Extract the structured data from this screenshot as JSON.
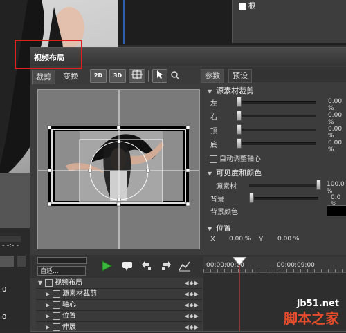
{
  "background_app": {
    "tree_root_label": "根"
  },
  "dialog": {
    "title": "视频布局",
    "left_tabs": [
      "裁剪",
      "变换"
    ],
    "mode_buttons": [
      "2D",
      "3D"
    ],
    "right_tabs": [
      "参数",
      "预设"
    ],
    "sections": {
      "crop": {
        "title": "源素材裁剪",
        "params": [
          {
            "label": "左",
            "value": "0.00 %",
            "level": 0
          },
          {
            "label": "右",
            "value": "0.00 %",
            "level": 0
          },
          {
            "label": "顶",
            "value": "0.00 %",
            "level": 0
          },
          {
            "label": "底",
            "value": "0.00 %",
            "level": 0
          }
        ],
        "auto_pivot_label": "自动调整轴心"
      },
      "visibility": {
        "title": "可见度和颜色",
        "source_label": "源素材",
        "source_value": "100.0 %",
        "source_level": 1.0,
        "background_label": "背景",
        "background_value": "0.0 %",
        "background_level": 0,
        "bgcolor_label": "背景颜色",
        "bgcolor": "#000000"
      },
      "position": {
        "title": "位置",
        "x_label": "X",
        "x_value": "0.00 %",
        "y_label": "Y",
        "y_value": "0.00 %"
      }
    },
    "bottom": {
      "fit_dropdown": "自适...",
      "timecodes": [
        "00:00:00;00",
        "00:00:09;00"
      ],
      "tracks": [
        {
          "label": "视频布局",
          "expanded": true,
          "indent": 0
        },
        {
          "label": "源素材裁剪",
          "expanded": false,
          "indent": 1
        },
        {
          "label": "轴心",
          "expanded": false,
          "indent": 1
        },
        {
          "label": "位置",
          "expanded": false,
          "indent": 1
        },
        {
          "label": "伸展",
          "expanded": false,
          "indent": 1
        }
      ]
    }
  },
  "watermark": {
    "url": "jb51.net",
    "name": "脚本之家"
  },
  "colors": {
    "highlight": "#e02020",
    "play_green": "#3cb83c",
    "playhead": "#e04040",
    "watermark_orange": "#e54c2b"
  }
}
